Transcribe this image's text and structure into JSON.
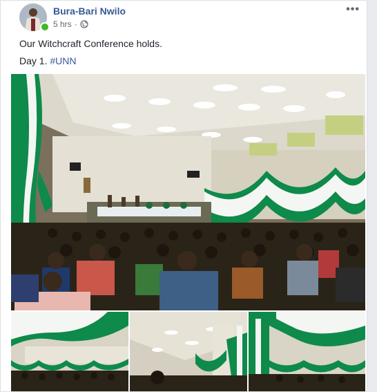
{
  "post": {
    "author": "Bura-Bari Nwilo",
    "time": "5 hrs",
    "privacy_icon": "globe-icon",
    "more_label": "•••",
    "text_line1": "Our Witchcraft Conference holds.",
    "text_line2_prefix": "Day 1.",
    "hashtag": "#UNN"
  },
  "colors": {
    "link": "#385898",
    "online": "#42b72a",
    "drape_green": "#0e8a4a",
    "drape_white": "#f4f6f3"
  },
  "photos": [
    {
      "name": "conference-hall-main-photo"
    },
    {
      "name": "conference-hall-thumb-1"
    },
    {
      "name": "conference-hall-thumb-2"
    },
    {
      "name": "conference-hall-thumb-3"
    }
  ]
}
